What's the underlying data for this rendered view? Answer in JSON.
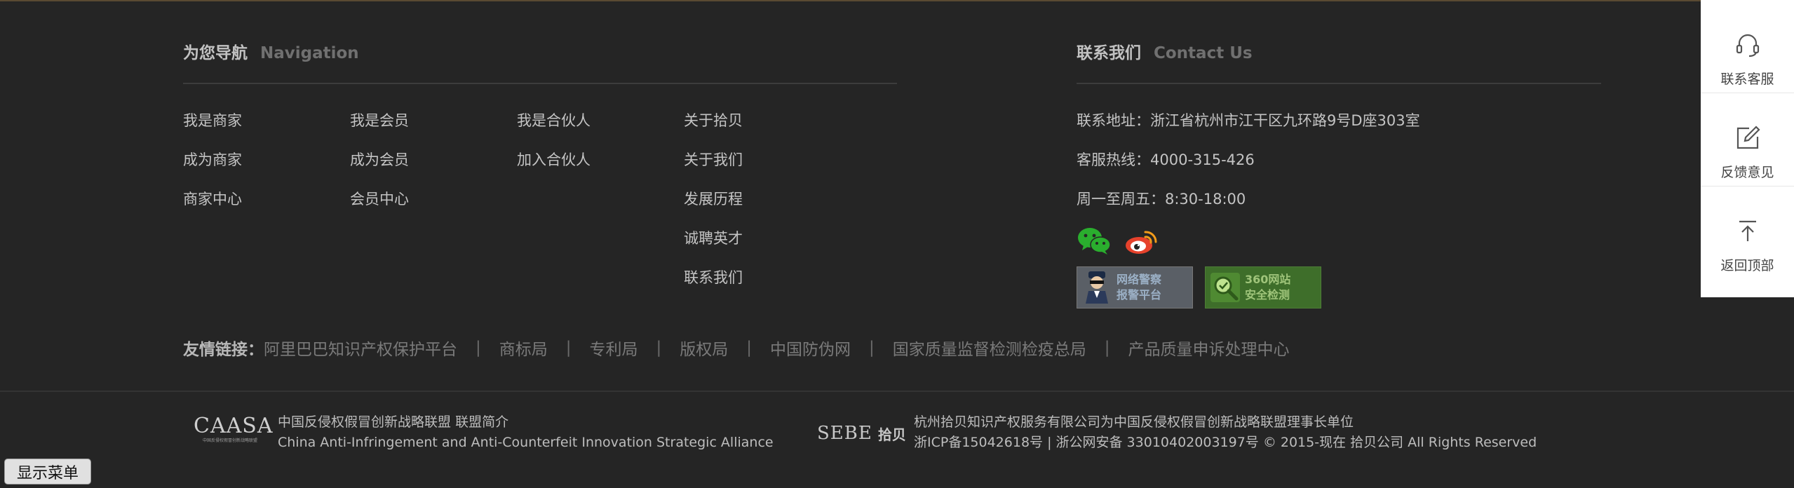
{
  "navigation": {
    "title_cn": "为您导航",
    "title_en": "Navigation",
    "columns": [
      [
        "我是商家",
        "成为商家",
        "商家中心"
      ],
      [
        "我是会员",
        "成为会员",
        "会员中心"
      ],
      [
        "我是合伙人",
        "加入合伙人"
      ],
      [
        "关于拾贝",
        "关于我们",
        "发展历程",
        "诚聘英才",
        "联系我们"
      ]
    ]
  },
  "contact": {
    "title_cn": "联系我们",
    "title_en": "Contact Us",
    "address": "联系地址：浙江省杭州市江干区九环路9号D座303室",
    "hotline": "客服热线：4000-315-426",
    "hours": "周一至周五：8:30-18:00",
    "social_icons": [
      "wechat-icon",
      "weibo-icon"
    ],
    "badges": [
      {
        "line1": "网络警察",
        "line2": "报警平台"
      },
      {
        "line1": "360网站",
        "line2": "安全检测"
      }
    ]
  },
  "friend_links": {
    "label": "友情链接：",
    "items": [
      "阿里巴巴知识产权保护平台",
      "商标局",
      "专利局",
      "版权局",
      "中国防伪网",
      "国家质量监督检测检疫总局",
      "产品质量申诉处理中心"
    ]
  },
  "bottom": {
    "caasa_logo": "CAASA",
    "caasa_logo_sub": "中国反侵权假冒创新战略联盟",
    "caasa_title": "中国反侵权假冒创新战略联盟",
    "caasa_intro_link": "联盟简介",
    "caasa_en": "China Anti-Infringement and Anti-Counterfeit Innovation Strategic Alliance",
    "sebe_logo_en": "SEBE",
    "sebe_logo_cn": "拾贝",
    "company_line": "杭州拾贝知识产权服务有限公司为中国反侵权假冒创新战略联盟理事长单位",
    "icp_line": "浙ICP备15042618号 | 浙公网安备 33010402003197号 © 2015-现在 拾贝公司 All Rights Reserved"
  },
  "show_menu": "显示菜单",
  "sidebar": {
    "items": [
      {
        "label": "联系客服",
        "icon": "headset-icon"
      },
      {
        "label": "反馈意见",
        "icon": "edit-icon"
      },
      {
        "label": "返回顶部",
        "icon": "back-to-top-icon"
      }
    ]
  },
  "colors": {
    "background": "#252525",
    "wechat": "#2aae2e",
    "weibo": "#e6422c"
  }
}
